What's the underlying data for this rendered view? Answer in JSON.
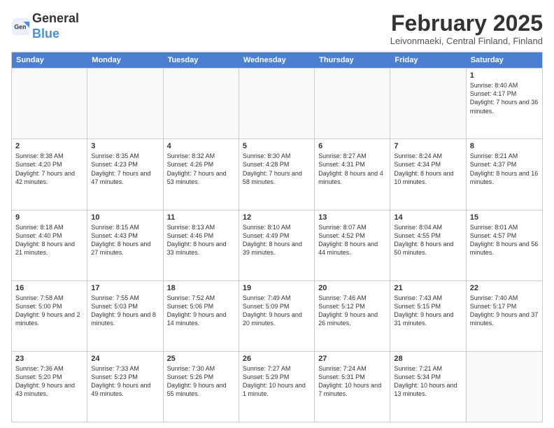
{
  "logo": {
    "general": "General",
    "blue": "Blue"
  },
  "title": "February 2025",
  "location": "Leivonmaeki, Central Finland, Finland",
  "days_header": [
    "Sunday",
    "Monday",
    "Tuesday",
    "Wednesday",
    "Thursday",
    "Friday",
    "Saturday"
  ],
  "weeks": [
    [
      {
        "day": "",
        "detail": ""
      },
      {
        "day": "",
        "detail": ""
      },
      {
        "day": "",
        "detail": ""
      },
      {
        "day": "",
        "detail": ""
      },
      {
        "day": "",
        "detail": ""
      },
      {
        "day": "",
        "detail": ""
      },
      {
        "day": "1",
        "detail": "Sunrise: 8:40 AM\nSunset: 4:17 PM\nDaylight: 7 hours\nand 36 minutes."
      }
    ],
    [
      {
        "day": "2",
        "detail": "Sunrise: 8:38 AM\nSunset: 4:20 PM\nDaylight: 7 hours\nand 42 minutes."
      },
      {
        "day": "3",
        "detail": "Sunrise: 8:35 AM\nSunset: 4:23 PM\nDaylight: 7 hours\nand 47 minutes."
      },
      {
        "day": "4",
        "detail": "Sunrise: 8:32 AM\nSunset: 4:26 PM\nDaylight: 7 hours\nand 53 minutes."
      },
      {
        "day": "5",
        "detail": "Sunrise: 8:30 AM\nSunset: 4:28 PM\nDaylight: 7 hours\nand 58 minutes."
      },
      {
        "day": "6",
        "detail": "Sunrise: 8:27 AM\nSunset: 4:31 PM\nDaylight: 8 hours\nand 4 minutes."
      },
      {
        "day": "7",
        "detail": "Sunrise: 8:24 AM\nSunset: 4:34 PM\nDaylight: 8 hours\nand 10 minutes."
      },
      {
        "day": "8",
        "detail": "Sunrise: 8:21 AM\nSunset: 4:37 PM\nDaylight: 8 hours\nand 16 minutes."
      }
    ],
    [
      {
        "day": "9",
        "detail": "Sunrise: 8:18 AM\nSunset: 4:40 PM\nDaylight: 8 hours\nand 21 minutes."
      },
      {
        "day": "10",
        "detail": "Sunrise: 8:15 AM\nSunset: 4:43 PM\nDaylight: 8 hours\nand 27 minutes."
      },
      {
        "day": "11",
        "detail": "Sunrise: 8:13 AM\nSunset: 4:46 PM\nDaylight: 8 hours\nand 33 minutes."
      },
      {
        "day": "12",
        "detail": "Sunrise: 8:10 AM\nSunset: 4:49 PM\nDaylight: 8 hours\nand 39 minutes."
      },
      {
        "day": "13",
        "detail": "Sunrise: 8:07 AM\nSunset: 4:52 PM\nDaylight: 8 hours\nand 44 minutes."
      },
      {
        "day": "14",
        "detail": "Sunrise: 8:04 AM\nSunset: 4:55 PM\nDaylight: 8 hours\nand 50 minutes."
      },
      {
        "day": "15",
        "detail": "Sunrise: 8:01 AM\nSunset: 4:57 PM\nDaylight: 8 hours\nand 56 minutes."
      }
    ],
    [
      {
        "day": "16",
        "detail": "Sunrise: 7:58 AM\nSunset: 5:00 PM\nDaylight: 9 hours\nand 2 minutes."
      },
      {
        "day": "17",
        "detail": "Sunrise: 7:55 AM\nSunset: 5:03 PM\nDaylight: 9 hours\nand 8 minutes."
      },
      {
        "day": "18",
        "detail": "Sunrise: 7:52 AM\nSunset: 5:06 PM\nDaylight: 9 hours\nand 14 minutes."
      },
      {
        "day": "19",
        "detail": "Sunrise: 7:49 AM\nSunset: 5:09 PM\nDaylight: 9 hours\nand 20 minutes."
      },
      {
        "day": "20",
        "detail": "Sunrise: 7:46 AM\nSunset: 5:12 PM\nDaylight: 9 hours\nand 26 minutes."
      },
      {
        "day": "21",
        "detail": "Sunrise: 7:43 AM\nSunset: 5:15 PM\nDaylight: 9 hours\nand 31 minutes."
      },
      {
        "day": "22",
        "detail": "Sunrise: 7:40 AM\nSunset: 5:17 PM\nDaylight: 9 hours\nand 37 minutes."
      }
    ],
    [
      {
        "day": "23",
        "detail": "Sunrise: 7:36 AM\nSunset: 5:20 PM\nDaylight: 9 hours\nand 43 minutes."
      },
      {
        "day": "24",
        "detail": "Sunrise: 7:33 AM\nSunset: 5:23 PM\nDaylight: 9 hours\nand 49 minutes."
      },
      {
        "day": "25",
        "detail": "Sunrise: 7:30 AM\nSunset: 5:26 PM\nDaylight: 9 hours\nand 55 minutes."
      },
      {
        "day": "26",
        "detail": "Sunrise: 7:27 AM\nSunset: 5:29 PM\nDaylight: 10 hours\nand 1 minute."
      },
      {
        "day": "27",
        "detail": "Sunrise: 7:24 AM\nSunset: 5:31 PM\nDaylight: 10 hours\nand 7 minutes."
      },
      {
        "day": "28",
        "detail": "Sunrise: 7:21 AM\nSunset: 5:34 PM\nDaylight: 10 hours\nand 13 minutes."
      },
      {
        "day": "",
        "detail": ""
      }
    ]
  ]
}
